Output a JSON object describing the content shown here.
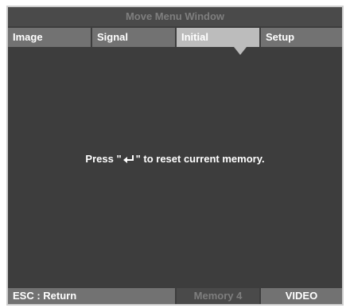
{
  "window": {
    "title": "Move Menu Window"
  },
  "tabs": [
    {
      "label": "Image"
    },
    {
      "label": "Signal"
    },
    {
      "label": "Initial",
      "selected": true
    },
    {
      "label": "Setup"
    }
  ],
  "main": {
    "message_before": "Press \"",
    "message_icon": "enter-return-icon",
    "message_after": "\" to reset current memory."
  },
  "status": {
    "esc_label": "ESC : Return",
    "memory_label": "Memory 4",
    "source_label": "VIDEO"
  },
  "colors": {
    "background": "#3d3d3d",
    "tab_bg": "#727272",
    "tab_selected_bg": "#bcbcbc",
    "title_text": "#7e7e7e",
    "text": "#ffffff"
  }
}
